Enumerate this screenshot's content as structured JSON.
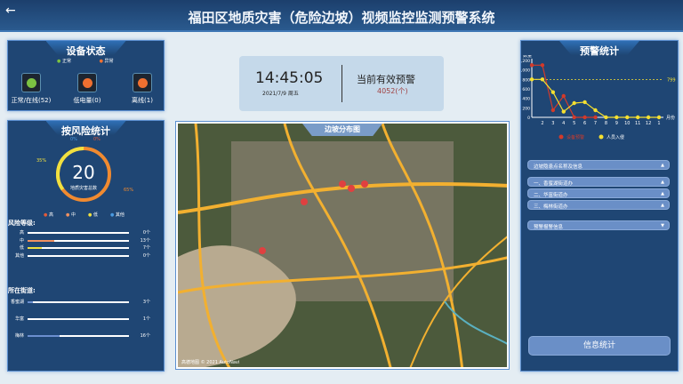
{
  "header": {
    "title": "福田区地质灾害（危险边坡）视频监控监测预警系统",
    "back_icon": "arrow-left"
  },
  "device_status": {
    "title": "设备状态",
    "legend": [
      {
        "label": "正常",
        "color": "#7cc242"
      },
      {
        "label": "异常",
        "color": "#f07030"
      }
    ],
    "items": [
      {
        "label": "正常/在线(52)",
        "color": "#7cc242"
      },
      {
        "label": "低电量(0)",
        "color": "#f07030"
      },
      {
        "label": "离线(1)",
        "color": "#f07030"
      }
    ]
  },
  "risk_stats": {
    "title": "按风险统计",
    "total": "20",
    "total_label": "地质灾害总数",
    "pct": [
      {
        "label": "0%",
        "color": "#4a9ae0"
      },
      {
        "label": "0%",
        "color": "#e05a3a"
      },
      {
        "label": "35%",
        "color": "#f0e040"
      },
      {
        "label": "65%",
        "color": "#f08a30"
      }
    ],
    "legend": [
      {
        "label": "高",
        "color": "#e05a3a"
      },
      {
        "label": "中",
        "color": "#f09060"
      },
      {
        "label": "低",
        "color": "#f0e040"
      },
      {
        "label": "其他",
        "color": "#4a9ae0"
      }
    ],
    "level_title": "风险等级:",
    "levels": [
      {
        "label": "高",
        "value": "0个",
        "frac": 0,
        "color": "#e05a3a"
      },
      {
        "label": "中",
        "value": "13个",
        "frac": 0.26,
        "color": "#f09060"
      },
      {
        "label": "低",
        "value": "7个",
        "frac": 0.14,
        "color": "#f0e040"
      },
      {
        "label": "其他",
        "value": "0个",
        "frac": 0,
        "color": "#4a9ae0"
      }
    ],
    "street_title": "所在街道:",
    "streets": [
      {
        "label": "香蜜湖",
        "value": "3个",
        "frac": 0.05,
        "color": "#6b8fd0"
      },
      {
        "label": "华富",
        "value": "1个",
        "frac": 0,
        "color": "#6b8fd0"
      },
      {
        "label": "梅林",
        "value": "16个",
        "frac": 0.32,
        "color": "#6b8fd0"
      }
    ]
  },
  "clock": {
    "time": "14:45:05",
    "date": "2021/7/9 周五",
    "alert_label": "当前有效预警",
    "alert_count": "4052(个)"
  },
  "map": {
    "title": "边坡分布图",
    "attribution": "高德地图 © 2021 AutoNavi"
  },
  "warning": {
    "title": "预警统计",
    "button": "信息统计",
    "accordion": [
      {
        "label": "边坡隐患点名称及信息",
        "arrow": "▲"
      },
      {
        "label": "一、香蜜湖街道办",
        "arrow": "▲"
      },
      {
        "label": "二、华富街道办",
        "arrow": "▲"
      },
      {
        "label": "三、梅林街道办",
        "arrow": "▲"
      },
      {
        "label": "预警报警信息",
        "arrow": "▼"
      }
    ]
  },
  "chart_data": {
    "type": "line",
    "ylabel": "数量",
    "xlabel": "月份",
    "ylim": [
      0,
      1200
    ],
    "yticks": [
      "0",
      "200",
      "400",
      "600",
      "800",
      "1,000",
      "1,200"
    ],
    "categories": [
      "",
      "2",
      "3",
      "4",
      "5",
      "6",
      "7",
      "8",
      "9",
      "10",
      "11",
      "12",
      "1"
    ],
    "series": [
      {
        "name": "设备预警",
        "color": "#d23a2a",
        "values": [
          1100,
          1100,
          150,
          450,
          0,
          0,
          0,
          null,
          null,
          null,
          null,
          null,
          null
        ]
      },
      {
        "name": "人员入侵",
        "color": "#f5e030",
        "values": [
          800,
          800,
          530,
          120,
          300,
          320,
          150,
          0,
          0,
          0,
          0,
          0,
          0
        ]
      }
    ],
    "markline": {
      "value": 799,
      "label": "799"
    }
  }
}
